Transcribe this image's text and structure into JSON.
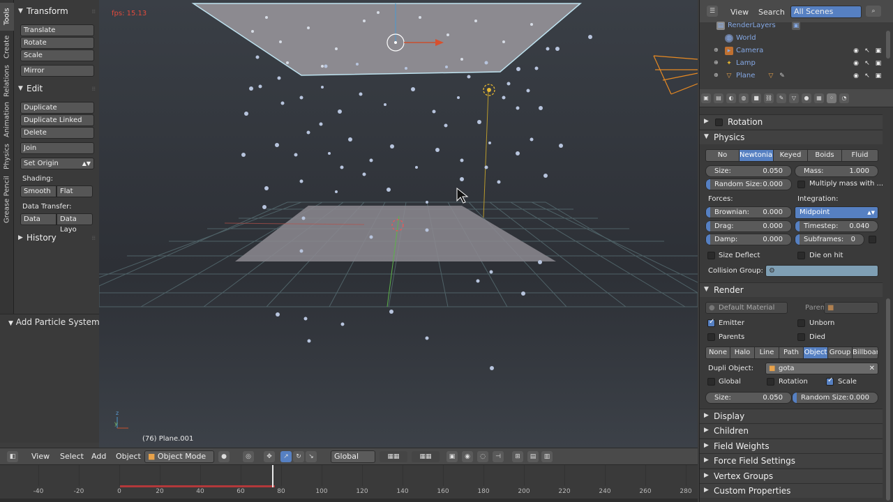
{
  "vtabs": [
    "Tools",
    "Create",
    "Relations",
    "Animation",
    "Physics",
    "Grease Pencil"
  ],
  "toolshelf": {
    "transform": {
      "title": "Transform",
      "buttons": [
        "Translate",
        "Rotate",
        "Scale"
      ],
      "mirror": "Mirror"
    },
    "edit": {
      "title": "Edit",
      "buttons": [
        "Duplicate",
        "Duplicate Linked",
        "Delete"
      ],
      "join": "Join",
      "set_origin": "Set Origin"
    },
    "shading": {
      "label": "Shading:",
      "smooth": "Smooth",
      "flat": "Flat"
    },
    "data_transfer": {
      "label": "Data Transfer:",
      "data": "Data",
      "data_layout": "Data Layo"
    },
    "history": "History"
  },
  "operator_panel": {
    "title": "Add Particle System Slo"
  },
  "viewport": {
    "fps": "fps: 15.13",
    "object_name": "(76) Plane.001",
    "axis_z": "z",
    "axis_y": "y"
  },
  "view3d_header": {
    "menus": [
      "View",
      "Select",
      "Add",
      "Object"
    ],
    "mode": "Object Mode",
    "orientation": "Global"
  },
  "timeline": {
    "ticks": [
      -40,
      -20,
      0,
      20,
      40,
      60,
      80,
      100,
      120,
      140,
      160,
      180,
      200,
      220,
      240,
      260,
      280
    ],
    "current_frame": 76
  },
  "outliner": {
    "header": {
      "view": "View",
      "search": "Search",
      "scene_filter": "All Scenes"
    },
    "rows": [
      {
        "name": "RenderLayers",
        "icon": "renderlayers-icon"
      },
      {
        "name": "World",
        "icon": "world-icon"
      },
      {
        "name": "Camera",
        "icon": "camera-icon"
      },
      {
        "name": "Lamp",
        "icon": "lamp-icon"
      },
      {
        "name": "Plane",
        "icon": "plane-icon"
      }
    ]
  },
  "properties": {
    "rotation": {
      "title": "Rotation"
    },
    "physics": {
      "title": "Physics",
      "types": [
        "No",
        "Newtonian",
        "Keyed",
        "Boids",
        "Fluid"
      ],
      "active_type": "Newtonian",
      "size_label": "Size:",
      "size_value": "0.050",
      "mass_label": "Mass:",
      "mass_value": "1.000",
      "random_size_label": "Random Size:",
      "random_size_value": "0.000",
      "multiply_mass": "Multiply mass with ...",
      "forces_label": "Forces:",
      "integration_label": "Integration:",
      "integration_value": "Midpoint",
      "brownian_label": "Brownian:",
      "brownian_value": "0.000",
      "drag_label": "Drag:",
      "drag_value": "0.000",
      "timestep_label": "Timestep:",
      "timestep_value": "0.040",
      "damp_label": "Damp:",
      "damp_value": "0.000",
      "subframes_label": "Subframes:",
      "subframes_value": "0",
      "size_deflect": "Size Deflect",
      "die_on_hit": "Die on hit",
      "collision_group": "Collision Group:"
    },
    "render": {
      "title": "Render",
      "material": "Default Material",
      "parent_label": "Parent:",
      "emitter": "Emitter",
      "unborn": "Unborn",
      "parents": "Parents",
      "died": "Died",
      "types": [
        "None",
        "Halo",
        "Line",
        "Path",
        "Object",
        "Group",
        "Billboar"
      ],
      "active_type": "Object",
      "dupli_object_label": "Dupli Object:",
      "dupli_object_value": "gota",
      "global": "Global",
      "rotation": "Rotation",
      "scale": "Scale",
      "size_label": "Size:",
      "size_value": "0.050",
      "random_size_label": "Random Size:",
      "random_size_value": "0.000"
    },
    "collapsed_sections": [
      "Display",
      "Children",
      "Field Weights",
      "Force Field Settings",
      "Vertex Groups",
      "Custom Properties"
    ]
  }
}
